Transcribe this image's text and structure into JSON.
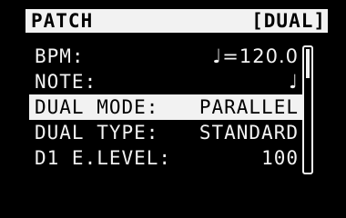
{
  "header": {
    "title": "PATCH",
    "mode": "[DUAL]"
  },
  "rows": [
    {
      "label": "BPM:",
      "value": "♩=120.0"
    },
    {
      "label": "NOTE:",
      "value": "♩"
    },
    {
      "label": "DUAL MODE:",
      "value": "PARALLEL"
    },
    {
      "label": "DUAL TYPE:",
      "value": "STANDARD"
    },
    {
      "label": "D1 E.LEVEL:",
      "value": "100"
    }
  ],
  "selected_row": "DUAL MODE:",
  "scrollbar": {
    "position_fraction": 0.0
  }
}
